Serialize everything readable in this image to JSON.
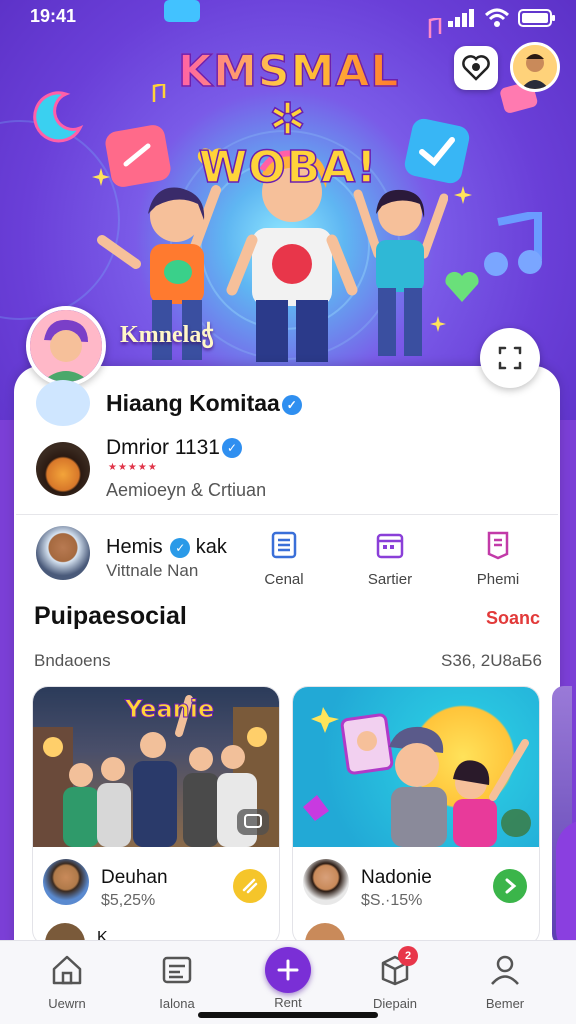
{
  "status_bar": {
    "time": "19:41"
  },
  "hero": {
    "title_line1": "KMSMAL",
    "title_line2": "WOBA!",
    "title_glyph": "✲",
    "caption": "Kmnelaჭ"
  },
  "profile": {
    "name": "Hiaang Komitaa",
    "verified": true
  },
  "featured": {
    "title": "Dmrior 1131",
    "stars": "★★★★★",
    "subtitle": "Aemioeyn & Crtiuan"
  },
  "creator": {
    "name": "Hemis",
    "name_suffix": "kak",
    "subtitle": "Vittnale Nan"
  },
  "quick_actions": [
    {
      "label": "Cenal",
      "icon": "news-icon"
    },
    {
      "label": "Sartier",
      "icon": "calendar-icon"
    },
    {
      "label": "Phemi",
      "icon": "document-icon"
    }
  ],
  "section": {
    "title": "Puipaesocial",
    "link": "Soanc",
    "sub_left": "Bndaoens",
    "sub_right": "S36, 2U8aБ6"
  },
  "cards": [
    {
      "name": "Deuhan",
      "price": "$5,25%",
      "action_icon": "ticket-icon",
      "action_color": "#f5c52a",
      "peek": "K..."
    },
    {
      "name": "Nadonie",
      "price": "$S.·15%",
      "action_icon": "play-icon",
      "action_color": "#3bb54a",
      "peek": "..."
    }
  ],
  "card1_art_text": "Yeanie",
  "bottom_nav": [
    {
      "label": "Uewrn",
      "icon": "home-icon"
    },
    {
      "label": "Ialona",
      "icon": "gallery-icon"
    },
    {
      "label": "Rent",
      "icon": "plus-icon"
    },
    {
      "label": "Diepain",
      "icon": "box-icon",
      "badge": "2"
    },
    {
      "label": "Bemer",
      "icon": "profile-icon"
    }
  ],
  "colors": {
    "accent": "#7a2fd6",
    "link": "#e23a3a",
    "verified": "#2f8ff0"
  }
}
